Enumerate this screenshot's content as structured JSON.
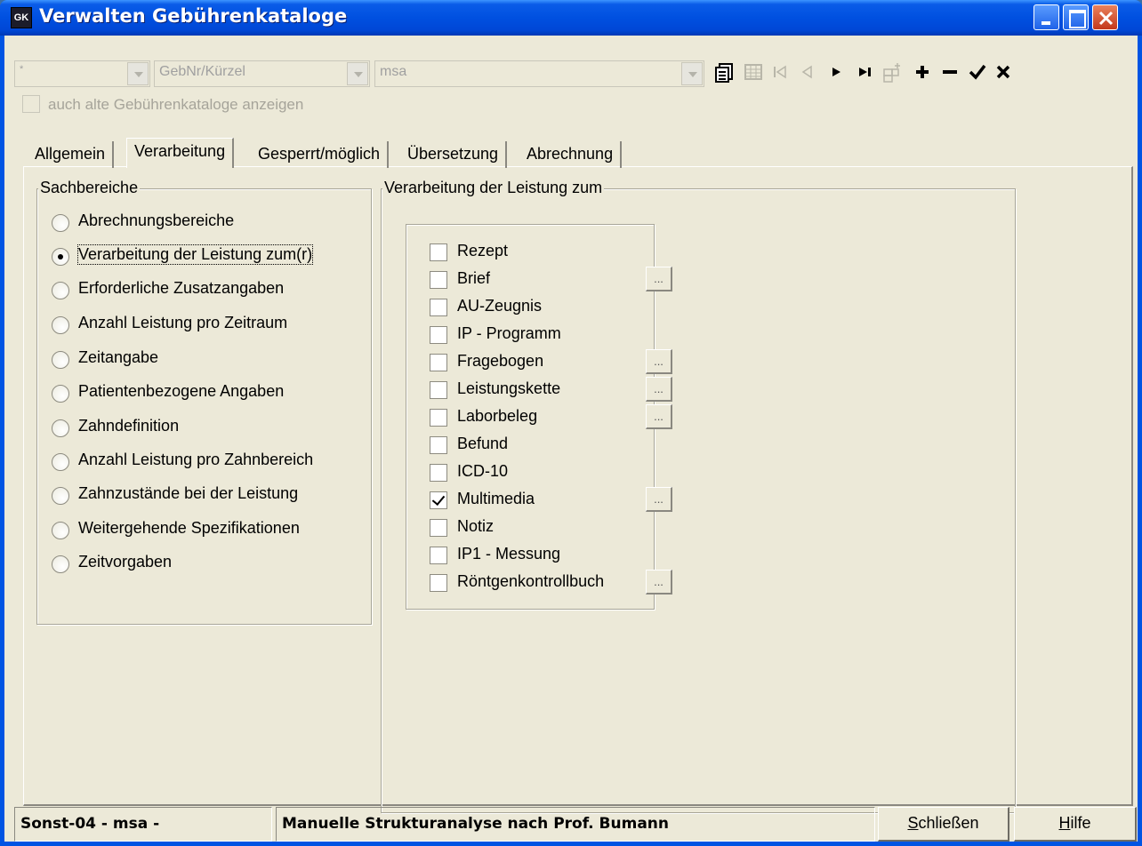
{
  "window": {
    "icon_text": "GK",
    "title": "Verwalten Gebührenkataloge"
  },
  "toolbar": {
    "filter_value": "*",
    "field_value": "GebNr/Kürzel",
    "search_value": "msa",
    "show_old_label": "auch alte Gebührenkataloge anzeigen",
    "show_old_checked": false
  },
  "tabs": [
    {
      "label": "Allgemein",
      "active": false
    },
    {
      "label": "Verarbeitung",
      "active": true
    },
    {
      "label": "Gesperrt/möglich",
      "active": false
    },
    {
      "label": "Übersetzung",
      "active": false
    },
    {
      "label": "Abrechnung",
      "active": false
    }
  ],
  "sachbereiche": {
    "title": "Sachbereiche",
    "items": [
      {
        "label": "Abrechnungsbereiche",
        "selected": false
      },
      {
        "label": "Verarbeitung der Leistung zum(r)",
        "selected": true
      },
      {
        "label": "Erforderliche Zusatzangaben",
        "selected": false
      },
      {
        "label": "Anzahl Leistung pro Zeitraum",
        "selected": false
      },
      {
        "label": "Zeitangabe",
        "selected": false
      },
      {
        "label": "Patientenbezogene Angaben",
        "selected": false
      },
      {
        "label": "Zahndefinition",
        "selected": false
      },
      {
        "label": "Anzahl Leistung pro Zahnbereich",
        "selected": false
      },
      {
        "label": "Zahnzustände bei der Leistung",
        "selected": false
      },
      {
        "label": "Weitergehende Spezifikationen",
        "selected": false
      },
      {
        "label": "Zeitvorgaben",
        "selected": false
      }
    ]
  },
  "verarbeitung": {
    "title": "Verarbeitung der Leistung zum",
    "items": [
      {
        "label": "Rezept",
        "checked": false,
        "has_button": false
      },
      {
        "label": "Brief",
        "checked": false,
        "has_button": true
      },
      {
        "label": "AU-Zeugnis",
        "checked": false,
        "has_button": false
      },
      {
        "label": "IP - Programm",
        "checked": false,
        "has_button": false
      },
      {
        "label": "Fragebogen",
        "checked": false,
        "has_button": true
      },
      {
        "label": "Leistungskette",
        "checked": false,
        "has_button": true
      },
      {
        "label": "Laborbeleg",
        "checked": false,
        "has_button": true
      },
      {
        "label": "Befund",
        "checked": false,
        "has_button": false
      },
      {
        "label": "ICD-10",
        "checked": false,
        "has_button": false
      },
      {
        "label": "Multimedia",
        "checked": true,
        "has_button": true
      },
      {
        "label": "Notiz",
        "checked": false,
        "has_button": false
      },
      {
        "label": "IP1 - Messung",
        "checked": false,
        "has_button": false
      },
      {
        "label": "Röntgenkontrollbuch",
        "checked": false,
        "has_button": true
      }
    ],
    "button_label": "..."
  },
  "statusbar": {
    "code": "Sonst-04 - msa -",
    "description": "Manuelle Strukturanalyse nach Prof. Bumann",
    "close_label_mnemonic": "S",
    "close_label_rest": "chließen",
    "help_label_mnemonic": "H",
    "help_label_rest": "ilfe"
  },
  "icons": {
    "copy": "copy-records-icon",
    "grid": "grid-view-icon",
    "first": "first-record-icon",
    "prev": "previous-record-icon",
    "next": "next-record-icon",
    "last": "last-record-icon",
    "newchild": "add-subrecord-icon",
    "add": "add-icon",
    "delete": "delete-icon",
    "confirm": "confirm-icon",
    "cancel": "cancel-icon"
  }
}
